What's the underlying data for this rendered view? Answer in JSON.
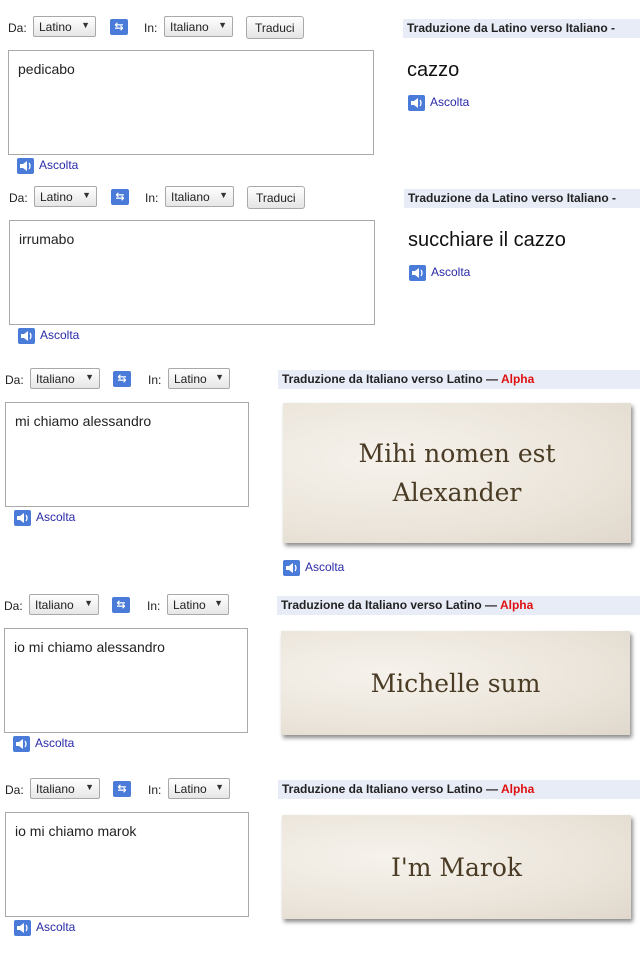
{
  "ui": {
    "from_label": "Da:",
    "to_label": "In:",
    "translate_button": "Traduci",
    "listen_label": "Ascolta",
    "alpha_label": "Alpha"
  },
  "icons": {
    "swap": "swap-languages-icon",
    "speaker": "speaker-icon",
    "dropdown": "dropdown-arrow-icon"
  },
  "colors": {
    "link": "#2a2aa8",
    "alpha": "#dd1111",
    "header_bg": "#e8ecf7",
    "accent": "#4a7bd8"
  },
  "panels": [
    {
      "from_lang": "Latino",
      "to_lang": "Italiano",
      "header": "Traduzione da Latino verso Italiano -",
      "input": "pedicabo",
      "output": "cazzo"
    },
    {
      "from_lang": "Latino",
      "to_lang": "Italiano",
      "header": "Traduzione da Latino verso Italiano -",
      "input": "irrumabo",
      "output": "succhiare il cazzo"
    },
    {
      "from_lang": "Italiano",
      "to_lang": "Latino",
      "header": "Traduzione da Italiano verso Latino —",
      "input": "mi chiamo alessandro",
      "output_line1": "Mihi nomen est",
      "output_line2": "Alexander"
    },
    {
      "from_lang": "Italiano",
      "to_lang": "Latino",
      "header": "Traduzione da Italiano verso Latino —",
      "input": "io mi chiamo alessandro",
      "output": "Michelle sum"
    },
    {
      "from_lang": "Italiano",
      "to_lang": "Latino",
      "header": "Traduzione da Italiano verso Latino —",
      "input": "io mi chiamo marok",
      "output": "I'm Marok"
    }
  ]
}
